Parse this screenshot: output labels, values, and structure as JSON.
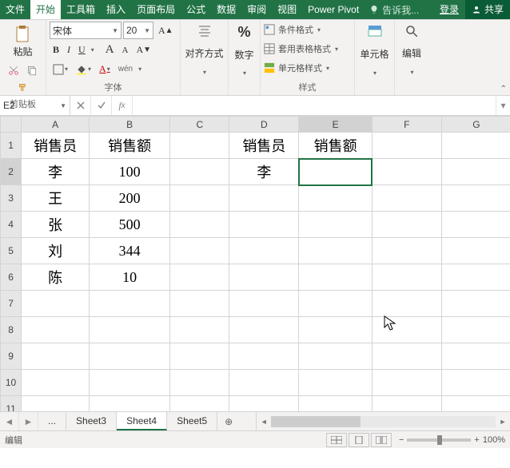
{
  "tabs": {
    "file": "文件",
    "home": "开始",
    "toolbox": "工具箱",
    "insert": "插入",
    "layout": "页面布局",
    "formulas": "公式",
    "data": "数据",
    "review": "审阅",
    "view": "视图",
    "powerpivot": "Power Pivot"
  },
  "tellme_placeholder": "告诉我...",
  "login": "登录",
  "share": "共享",
  "ribbon": {
    "clipboard": {
      "paste": "粘贴",
      "label": "剪贴板"
    },
    "font": {
      "name": "宋体",
      "size": "20",
      "label": "字体",
      "bold": "B",
      "italic": "I",
      "underline": "U",
      "wen": "wén"
    },
    "align": {
      "label": "对齐方式"
    },
    "number": {
      "label": "数字",
      "percent": "%"
    },
    "styles": {
      "label": "样式",
      "cond": "条件格式",
      "table": "套用表格格式",
      "cell": "单元格样式"
    },
    "cells": {
      "label": "单元格"
    },
    "editing": {
      "label": "编辑"
    }
  },
  "namebox": "E2",
  "formula": "",
  "columns": [
    "A",
    "B",
    "C",
    "D",
    "E",
    "F",
    "G"
  ],
  "rows": [
    "1",
    "2",
    "3",
    "4",
    "5",
    "6",
    "7",
    "8",
    "9",
    "10",
    "11"
  ],
  "cells": {
    "A1": "销售员",
    "B1": "销售额",
    "A2": "李",
    "B2": "100",
    "A3": "王",
    "B3": "200",
    "A4": "张",
    "B4": "500",
    "A5": "刘",
    "B5": "344",
    "A6": "陈",
    "B6": "10",
    "D1": "销售员",
    "E1": "销售额",
    "D2": "李"
  },
  "active_cell": "E2",
  "sheets": {
    "dots": "...",
    "s3": "Sheet3",
    "s4": "Sheet4",
    "s5": "Sheet5"
  },
  "status": {
    "mode": "编辑",
    "zoom": "100%",
    "minus": "−",
    "plus": "+"
  }
}
